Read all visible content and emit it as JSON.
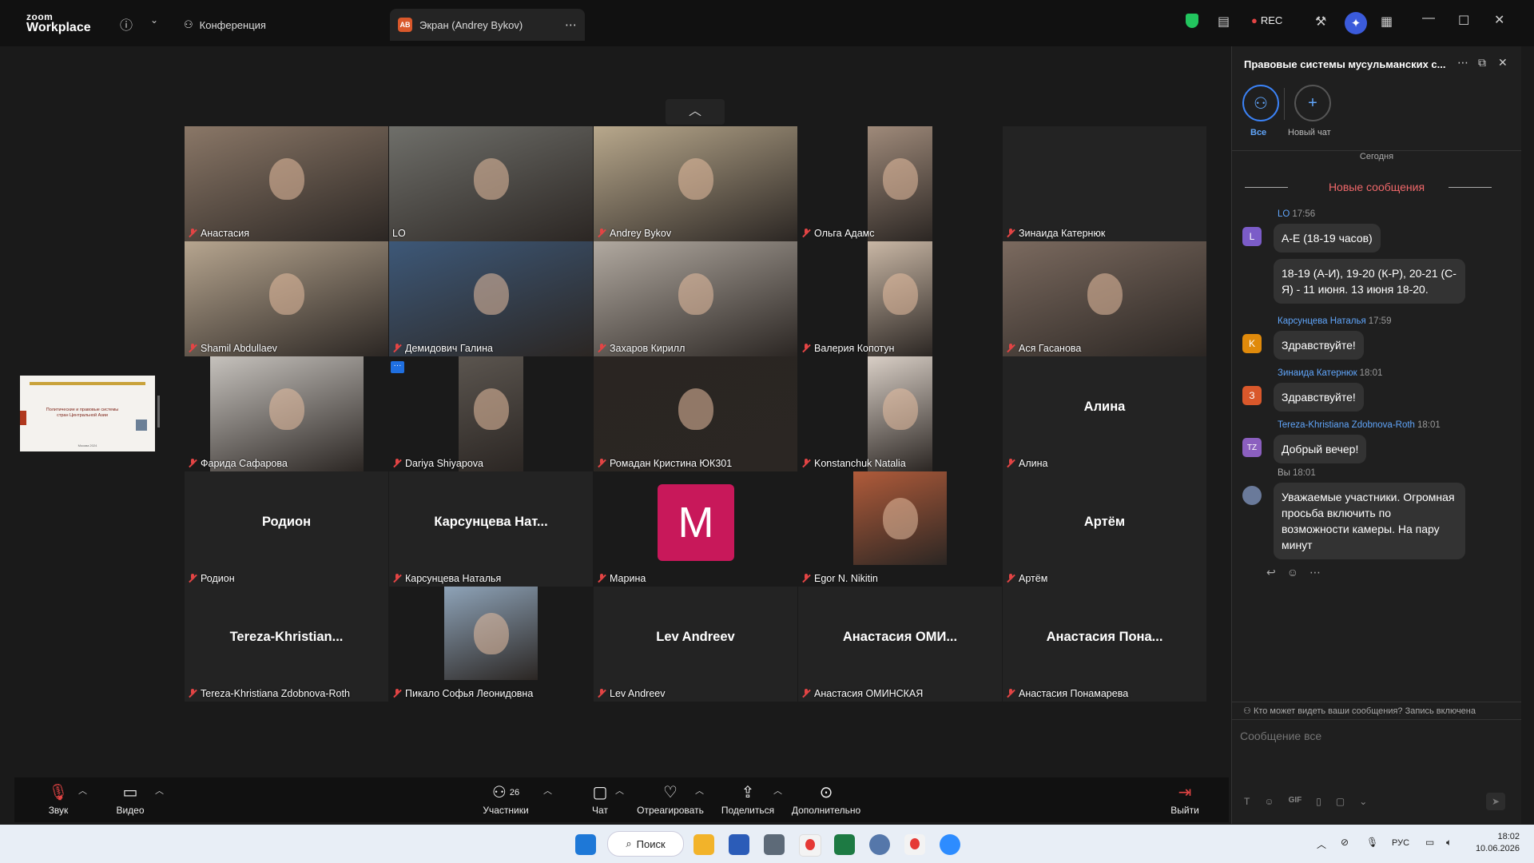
{
  "app": {
    "brand_top": "zoom",
    "brand_bottom": "Workplace",
    "tabs": [
      {
        "label": "Конференция"
      },
      {
        "label": "Экран (Andrey Bykov)",
        "avatar": "AB"
      }
    ],
    "rec_label": "REC"
  },
  "participants": [
    {
      "name": "Анастасия",
      "type": "video",
      "bg": "#8a7767"
    },
    {
      "name": "LO",
      "type": "video",
      "bg": "#6f6f6a",
      "speaking": true
    },
    {
      "name": "Andrey Bykov",
      "type": "video",
      "bg": "#b8a88c"
    },
    {
      "name": "Ольга Адамс",
      "type": "video-narrow",
      "bg": "#9f8a7a"
    },
    {
      "name": "Зинаида Катернюк",
      "type": "blank"
    },
    {
      "name": "Shamil Abdullaev",
      "type": "video",
      "bg": "#b6a58f"
    },
    {
      "name": "Демидович Галина",
      "type": "video",
      "bg": "#3d5878"
    },
    {
      "name": "Захаров Кирилл",
      "type": "video",
      "bg": "#b1a9a0"
    },
    {
      "name": "Валерия Копотун",
      "type": "video-narrow",
      "bg": "#c9b7a5"
    },
    {
      "name": "Ася Гасанова",
      "type": "video",
      "bg": "#7b6a5f"
    },
    {
      "name": "Фарида Сафарова",
      "type": "video-mid",
      "bg": "#c6c2bd"
    },
    {
      "name": "Dariya Shiyapova",
      "type": "video-narrow2",
      "bg": "#5b554f"
    },
    {
      "name": "Ромадан Кристина ЮК301",
      "type": "video",
      "bg": "#2a2522"
    },
    {
      "name": "Konstanchuk Natalia",
      "type": "video-narrow",
      "bg": "#d9cfc6"
    },
    {
      "name": "Алина",
      "type": "name",
      "display": "Алина"
    },
    {
      "name": "Родион",
      "type": "name",
      "display": "Родион"
    },
    {
      "name": "Карсунцева Наталья",
      "type": "name",
      "display": "Карсунцева  Нат..."
    },
    {
      "name": "Марина",
      "type": "avatar",
      "letter": "M"
    },
    {
      "name": "Egor N. Nikitin",
      "type": "photo",
      "bg": "#b05b3a"
    },
    {
      "name": "Артём",
      "type": "name",
      "display": "Артём"
    },
    {
      "name": "Tereza-Khristiana Zdobnova-Roth",
      "type": "name",
      "display": "Tereza-Khristian..."
    },
    {
      "name": "Пикало Софья Леонидовна",
      "type": "photo",
      "bg": "#8ea3b8"
    },
    {
      "name": "Lev Andreev",
      "type": "name",
      "display": "Lev Andreev"
    },
    {
      "name": "Анастасия ОМИНСКАЯ",
      "type": "name",
      "display": "Анастасия  ОМИ..."
    },
    {
      "name": "Анастасия Понамарева",
      "type": "name",
      "display": "Анастасия  Пона..."
    }
  ],
  "thumbnail": {
    "title": "Политические и правовые системы стран Центральной Азии",
    "footer": "Москва 2024"
  },
  "toolbar": {
    "audio": "Звук",
    "video": "Видео",
    "participants": "Участники",
    "participants_count": "26",
    "chat": "Чат",
    "react": "Отреагировать",
    "share": "Поделиться",
    "more": "Дополнительно",
    "leave": "Выйти"
  },
  "chat": {
    "title": "Правовые системы мусульманских с...",
    "chips": {
      "all": "Все",
      "new": "Новый чат"
    },
    "day": "Сегодня",
    "new_messages": "Новые сообщения",
    "messages": [
      {
        "initial": "L",
        "color": "#7b5cc8",
        "sender": "LO",
        "time": "17:56",
        "texts": [
          "А-Е (18-19 часов)",
          "18-19 (А-И), 19-20 (К-Р), 20-21 (С-Я) - 11 июня. 13 июня 18-20."
        ]
      },
      {
        "initial": "K",
        "color": "#e08a0b",
        "sender": "Карсунцева Наталья",
        "time": "17:59",
        "texts": [
          "Здравствуйте!"
        ]
      },
      {
        "initial": "З",
        "color": "#d9582b",
        "sender": "Зинаида Катернюк",
        "time": "18:01",
        "texts": [
          "Здравствуйте!"
        ]
      },
      {
        "initial": "TZ",
        "color": "#8b5fbf",
        "sender": "Tereza-Khristiana Zdobnova-Roth",
        "time": "18:01",
        "texts": [
          "Добрый вечер!"
        ]
      },
      {
        "initial": "",
        "color": "#6a7a9a",
        "sender": "Вы",
        "time": "18:01",
        "texts": [
          "Уважаемые участники. Огромная просьба включить по возможности камеры. На пару минут"
        ]
      }
    ],
    "privacy": "Кто может видеть ваши сообщения? Запись включена",
    "input_placeholder": "Сообщение все"
  },
  "taskbar": {
    "search": "Поиск",
    "lang": "РУС",
    "time": "18:02",
    "date": "10.06.2026"
  }
}
